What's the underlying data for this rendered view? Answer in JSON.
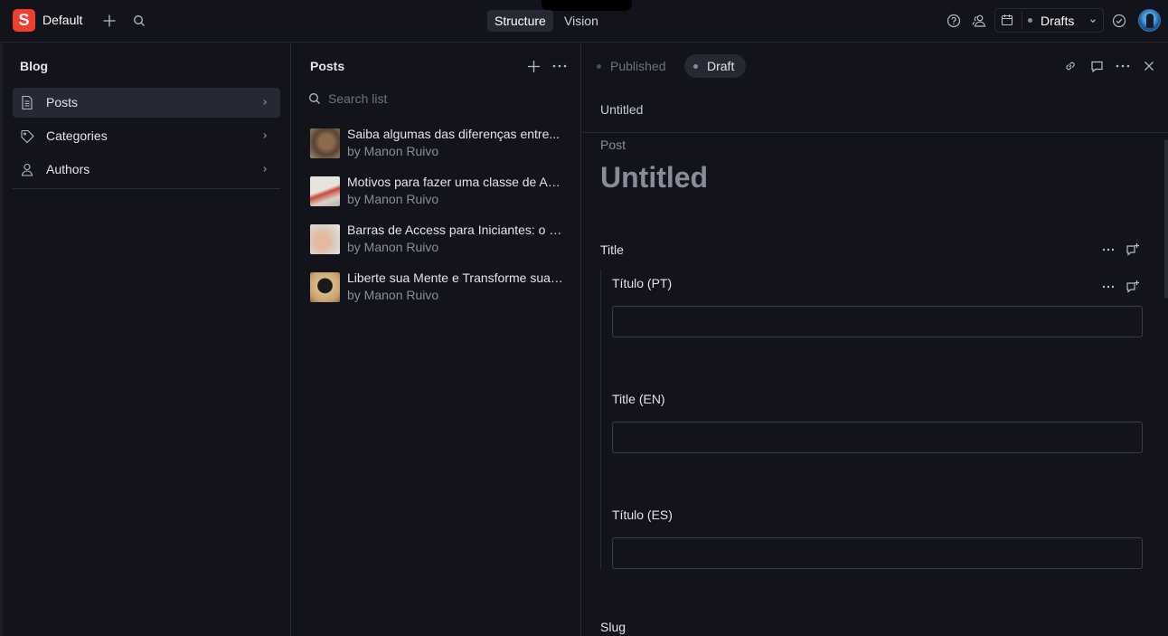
{
  "topbar": {
    "logo_letter": "S",
    "workspace_name": "Default",
    "tools": [
      {
        "label": "Structure",
        "active": true
      },
      {
        "label": "Vision",
        "active": false
      }
    ],
    "perspective_label": "Drafts"
  },
  "left_pane": {
    "title": "Blog",
    "items": [
      {
        "label": "Posts",
        "icon": "document-icon",
        "active": true
      },
      {
        "label": "Categories",
        "icon": "tag-icon",
        "active": false
      },
      {
        "label": "Authors",
        "icon": "user-icon",
        "active": false
      }
    ]
  },
  "mid_pane": {
    "title": "Posts",
    "search_placeholder": "Search list",
    "posts": [
      {
        "title": "Saiba algumas das diferenças entre...",
        "author": "by Manon Ruivo"
      },
      {
        "title": "Motivos para fazer uma classe de Access...",
        "author": "by Manon Ruivo"
      },
      {
        "title": "Barras de Access para Iniciantes: o que...",
        "author": "by Manon Ruivo"
      },
      {
        "title": "Liberte sua Mente e Transforme sua vida...",
        "author": "by Manon Ruivo"
      }
    ]
  },
  "editor": {
    "status_published": "Published",
    "status_draft": "Draft",
    "breadcrumb_title": "Untitled",
    "doc_type": "Post",
    "doc_title": "Untitled",
    "fields": {
      "title_group_label": "Title",
      "title_pt_label": "Título (PT)",
      "title_en_label": "Title (EN)",
      "title_es_label": "Título (ES)",
      "title_pt_value": "",
      "title_en_value": "",
      "title_es_value": "",
      "slug_label": "Slug"
    }
  },
  "colors": {
    "background": "#13141b",
    "accent_logo": "#f03e2f",
    "active_item": "#262833",
    "border": "#2a2c35"
  }
}
